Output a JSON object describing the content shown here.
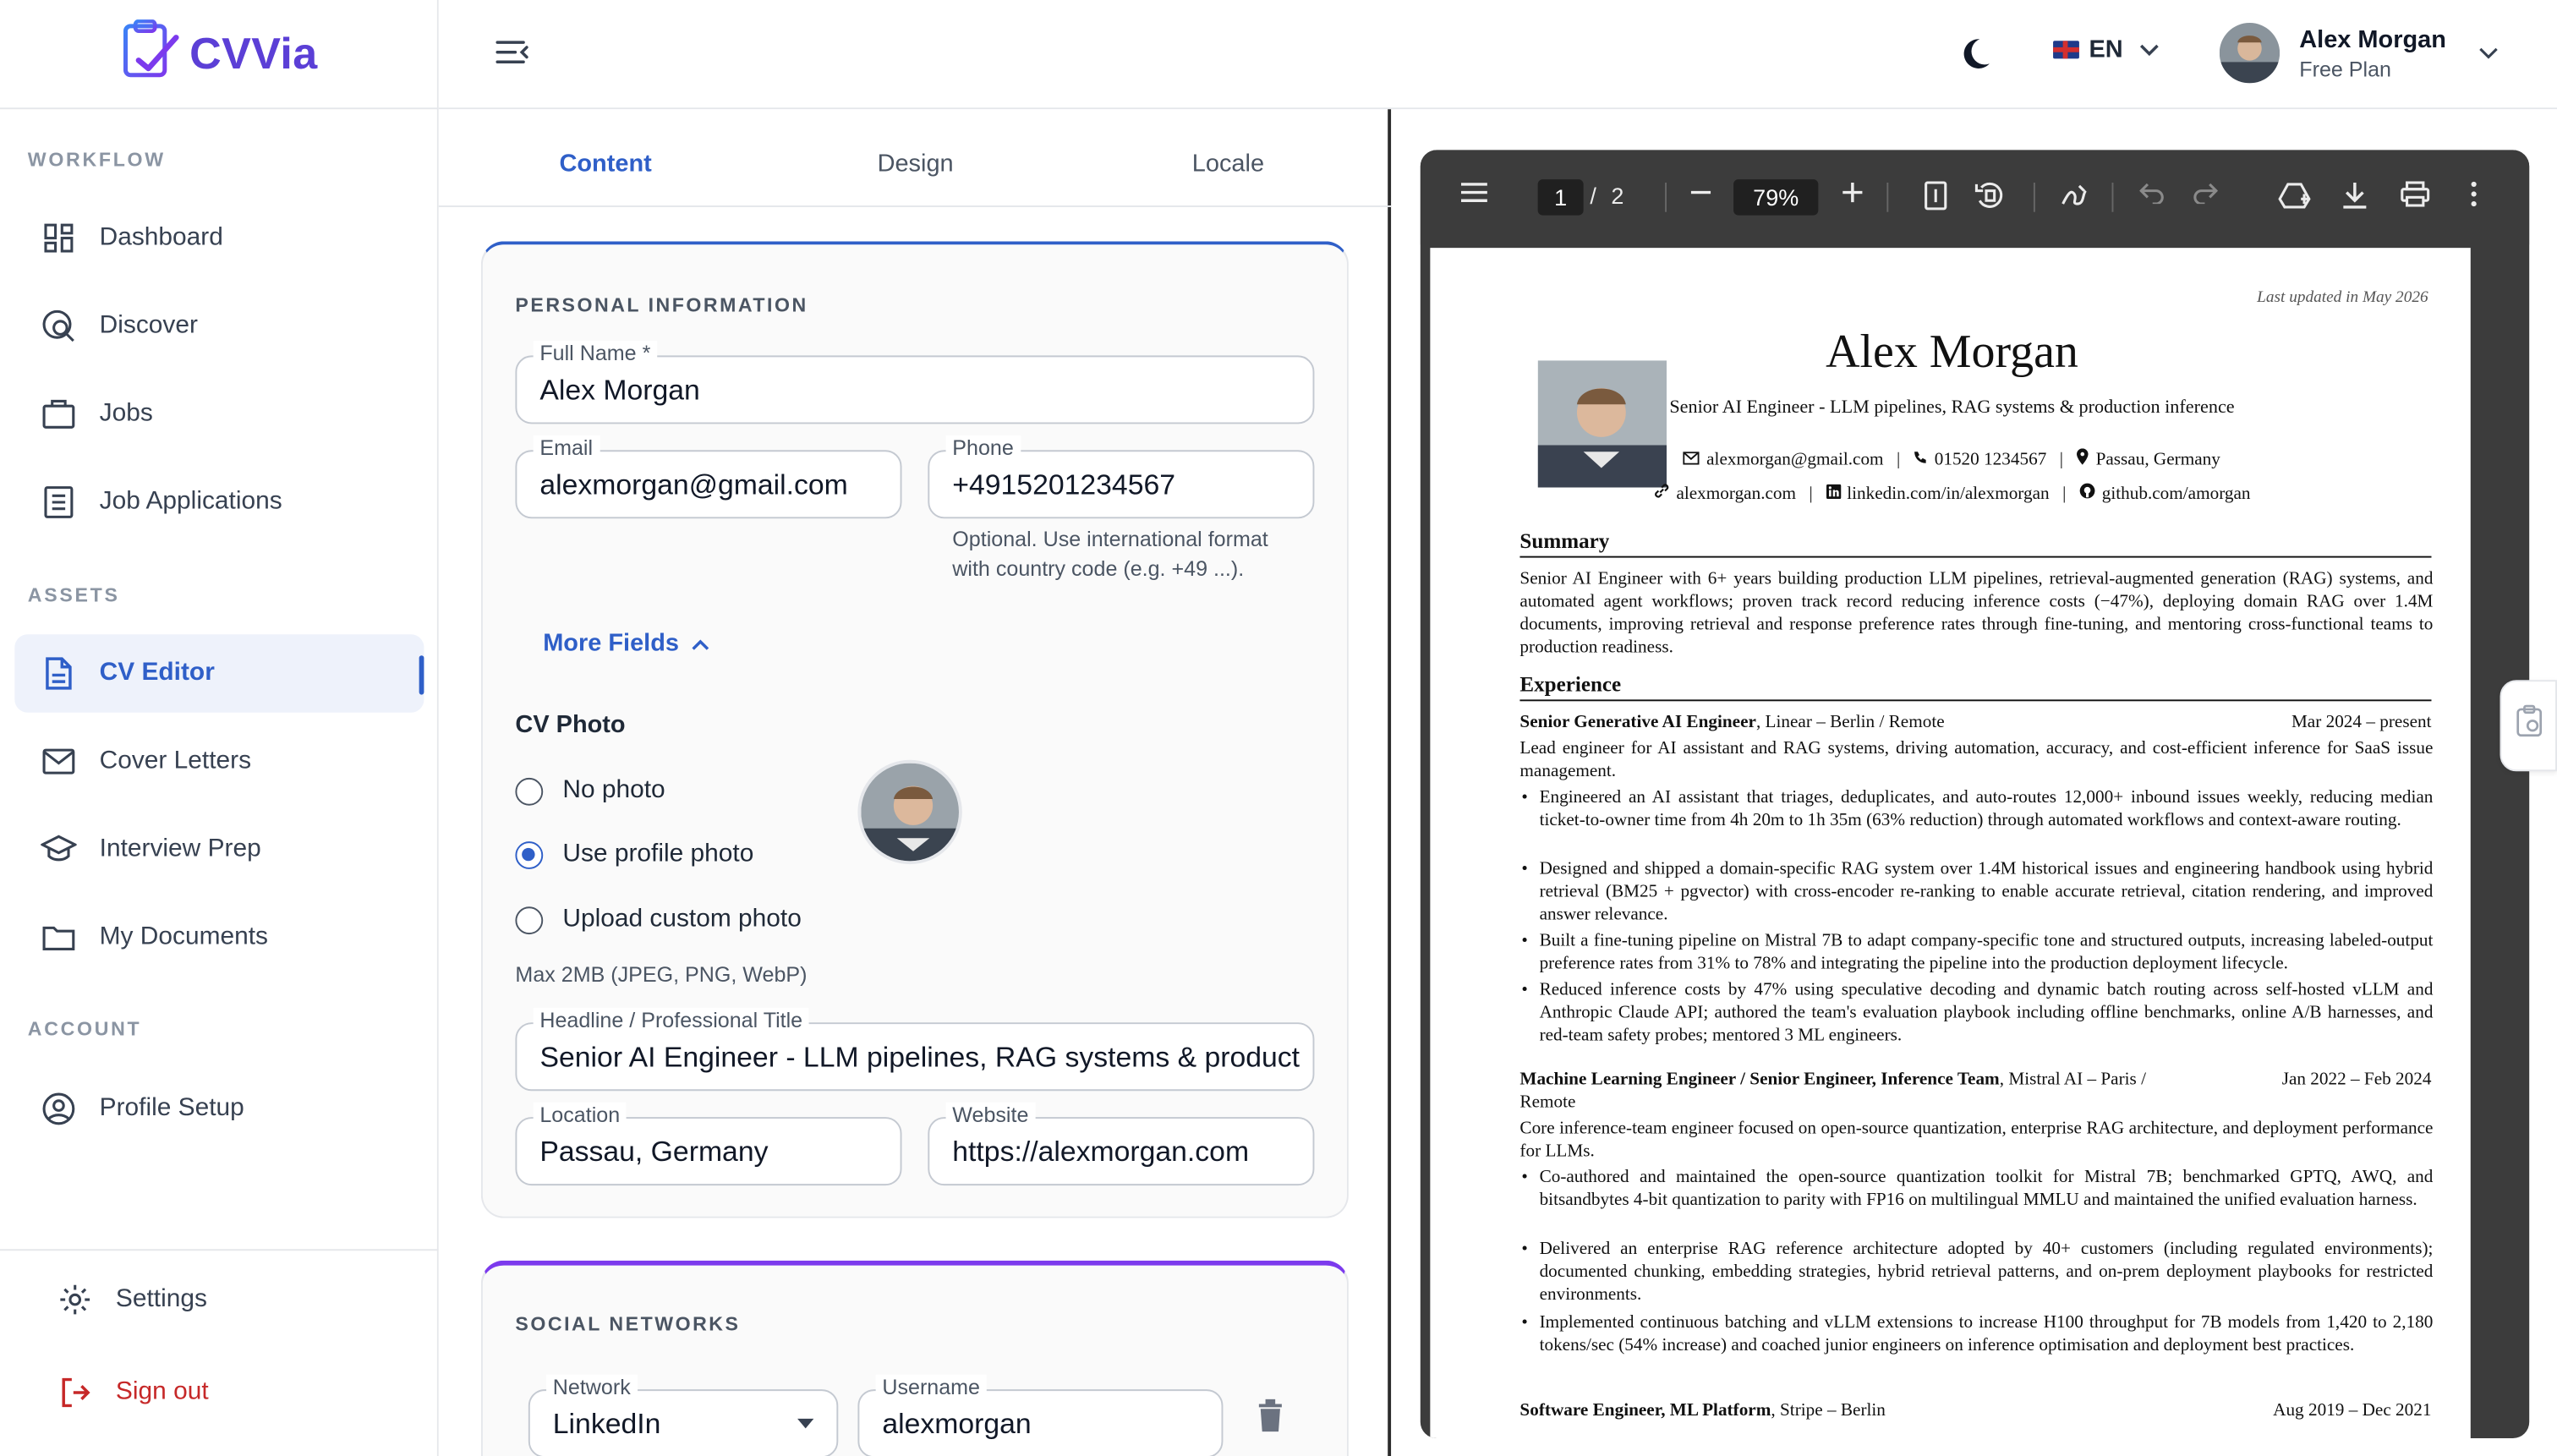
{
  "brand": {
    "name": "CVVia"
  },
  "sidebar": {
    "sections": [
      {
        "title": "WORKFLOW"
      },
      {
        "title": "ASSETS"
      },
      {
        "title": "ACCOUNT"
      }
    ],
    "items": [
      {
        "label": "Dashboard",
        "icon": "dashboard-icon"
      },
      {
        "label": "Discover",
        "icon": "discover-icon"
      },
      {
        "label": "Jobs",
        "icon": "briefcase-icon"
      },
      {
        "label": "Job Applications",
        "icon": "list-document-icon"
      },
      {
        "label": "CV Editor",
        "icon": "document-icon",
        "active": true
      },
      {
        "label": "Cover Letters",
        "icon": "mail-icon"
      },
      {
        "label": "Interview Prep",
        "icon": "graduation-cap-icon"
      },
      {
        "label": "My Documents",
        "icon": "folder-icon"
      },
      {
        "label": "Profile Setup",
        "icon": "user-circle-icon"
      }
    ],
    "settings_label": "Settings",
    "signout_label": "Sign out"
  },
  "topbar": {
    "language": "EN",
    "user": {
      "name": "Alex Morgan",
      "plan": "Free Plan"
    }
  },
  "editor": {
    "tabs": [
      {
        "label": "Content",
        "active": true
      },
      {
        "label": "Design"
      },
      {
        "label": "Locale"
      }
    ],
    "personal": {
      "title": "PERSONAL INFORMATION",
      "full_name_label": "Full Name *",
      "full_name": "Alex Morgan",
      "email_label": "Email",
      "email": "alexmorgan@gmail.com",
      "phone_label": "Phone",
      "phone": "+4915201234567",
      "phone_hint_1": "Optional. Use international format",
      "phone_hint_2": "with country code (e.g. +49 ...).",
      "more_fields": "More Fields",
      "cv_photo_title": "CV Photo",
      "photo_options": [
        "No photo",
        "Use profile photo",
        "Upload custom photo"
      ],
      "photo_selected": "Use profile photo",
      "max_note": "Max 2MB (JPEG, PNG, WebP)",
      "headline_label": "Headline / Professional Title",
      "headline": "Senior AI Engineer - LLM pipelines, RAG systems & production inference",
      "location_label": "Location",
      "location": "Passau, Germany",
      "website_label": "Website",
      "website": "https://alexmorgan.com"
    },
    "social": {
      "title": "SOCIAL NETWORKS",
      "network_label": "Network",
      "network": "LinkedIn",
      "username_label": "Username",
      "username": "alexmorgan"
    }
  },
  "viewer": {
    "page_current": "1",
    "page_sep": "/",
    "page_total": "2",
    "zoom": "79%"
  },
  "cv": {
    "updated": "Last updated in May 2026",
    "name": "Alex Morgan",
    "headline": "Senior AI Engineer - LLM pipelines, RAG systems & production inference",
    "email": "alexmorgan@gmail.com",
    "phone": "01520 1234567",
    "location": "Passau, Germany",
    "website": "alexmorgan.com",
    "linkedin": "linkedin.com/in/alexmorgan",
    "github": "github.com/amorgan",
    "summary_title": "Summary",
    "summary": "Senior AI Engineer with 6+ years building production LLM pipelines, retrieval-augmented generation (RAG) systems, and automated agent workflows; proven track record reducing inference costs (−47%), deploying domain RAG over 1.4M documents, improving retrieval and response preference rates through fine-tuning, and mentoring cross-functional teams to production readiness.",
    "experience_title": "Experience",
    "jobs": [
      {
        "role": "Senior Generative AI Engineer",
        "company": ", Linear – Berlin / Remote",
        "dates": "Mar 2024 – present",
        "desc": "Lead engineer for AI assistant and RAG systems, driving automation, accuracy, and cost-efficient inference for SaaS issue management.",
        "bullets": [
          "Engineered an AI assistant that triages, deduplicates, and auto-routes 12,000+ inbound issues weekly, reducing median ticket-to-owner time from 4h 20m to 1h 35m (63% reduction) through automated workflows and context-aware routing.",
          "Designed and shipped a domain-specific RAG system over 1.4M historical issues and engineering handbook using hybrid retrieval (BM25 + pgvector) with cross-encoder re-ranking to enable accurate retrieval, citation rendering, and improved answer relevance.",
          "Built a fine-tuning pipeline on Mistral 7B to adapt company-specific tone and structured outputs, increasing labeled-output preference rates from 31% to 78% and integrating the pipeline into the production deployment lifecycle.",
          "Reduced inference costs by 47% using speculative decoding and dynamic batch routing across self-hosted vLLM and Anthropic Claude API; authored the team's evaluation playbook including offline benchmarks, online A/B harnesses, and red-team safety probes; mentored 3 ML engineers."
        ]
      },
      {
        "role": "Machine Learning Engineer / Senior Engineer, Inference Team",
        "company": ", Mistral AI – Paris /",
        "company2": "Remote",
        "dates": "Jan 2022 – Feb 2024",
        "desc": "Core inference-team engineer focused on open-source quantization, enterprise RAG architecture, and deployment performance for LLMs.",
        "bullets": [
          "Co-authored and maintained the open-source quantization toolkit for Mistral 7B; benchmarked GPTQ, AWQ, and bitsandbytes 4-bit quantization to parity with FP16 on multilingual MMLU and maintained the unified evaluation harness.",
          "Delivered an enterprise RAG reference architecture adopted by 40+ customers (including regulated environments); documented chunking, embedding strategies, hybrid retrieval patterns, and on-prem deployment playbooks for restricted environments.",
          "Implemented continuous batching and vLLM extensions to increase H100 throughput for 7B models from 1,420 to 2,180 tokens/sec (54% increase) and coached junior engineers on inference optimisation and deployment best practices."
        ]
      },
      {
        "role": "Software Engineer, ML Platform",
        "company": ", Stripe – Berlin",
        "dates": "Aug 2019 – Dec 2021"
      }
    ]
  },
  "colors": {
    "accent": "#2f5fc8",
    "brand": "#5b3fd6",
    "danger": "#c62828",
    "social_accent": "#7c3aed"
  }
}
